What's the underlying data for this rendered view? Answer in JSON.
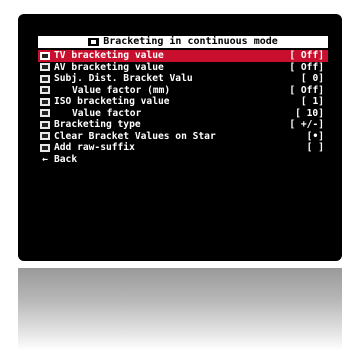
{
  "menu": {
    "title": "Bracketing in continuous mode",
    "title_icon": "bracketing-icon",
    "items": [
      {
        "label": "TV bracketing value",
        "value": "[    Off]",
        "icon": "tv-icon",
        "selected": true
      },
      {
        "label": "AV bracketing value",
        "value": "[    Off]",
        "icon": "av-icon",
        "selected": false
      },
      {
        "label": "Subj. Dist. Bracket Valu",
        "value": "[      0]",
        "icon": "subject-distance-icon",
        "selected": false
      },
      {
        "label": "Value factor (mm)",
        "value": "[    Off]",
        "icon": "value-factor-icon",
        "selected": false
      },
      {
        "label": "ISO bracketing value",
        "value": "[      1]",
        "icon": "iso-icon",
        "selected": false
      },
      {
        "label": "Value factor",
        "value": "[     10]",
        "icon": "value-factor-icon",
        "selected": false
      },
      {
        "label": "Bracketing type",
        "value": "[    +/-]",
        "icon": "bracketing-type-icon",
        "selected": false
      },
      {
        "label": "Clear Bracket Values on Star",
        "value": "[•]",
        "icon": "clear-icon",
        "selected": false
      },
      {
        "label": "Add raw-suffix",
        "value": "[ ]",
        "icon": "raw-icon",
        "selected": false
      }
    ],
    "back_label": "Back",
    "back_icon": "back-arrow-icon"
  },
  "colors": {
    "screen_bg": "#000000",
    "highlight": "#c8102e",
    "text": "#ffffff",
    "title_bg": "#ffffff"
  }
}
